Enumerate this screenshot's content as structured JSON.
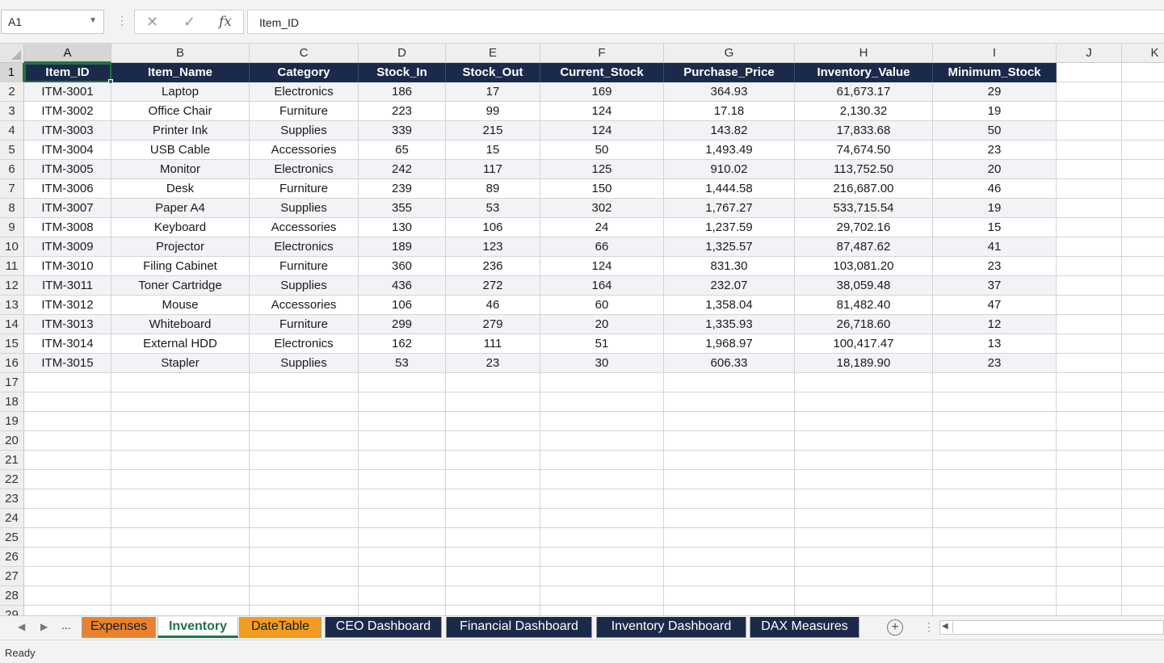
{
  "formula_bar": {
    "name_box": "A1",
    "formula": "Item_ID"
  },
  "columns": [
    "A",
    "B",
    "C",
    "D",
    "E",
    "F",
    "G",
    "H",
    "I",
    "J",
    "K"
  ],
  "table": {
    "headers": [
      "Item_ID",
      "Item_Name",
      "Category",
      "Stock_In",
      "Stock_Out",
      "Current_Stock",
      "Purchase_Price",
      "Inventory_Value",
      "Minimum_Stock"
    ],
    "rows": [
      [
        "ITM-3001",
        "Laptop",
        "Electronics",
        "186",
        "17",
        "169",
        "364.93",
        "61,673.17",
        "29"
      ],
      [
        "ITM-3002",
        "Office Chair",
        "Furniture",
        "223",
        "99",
        "124",
        "17.18",
        "2,130.32",
        "19"
      ],
      [
        "ITM-3003",
        "Printer Ink",
        "Supplies",
        "339",
        "215",
        "124",
        "143.82",
        "17,833.68",
        "50"
      ],
      [
        "ITM-3004",
        "USB Cable",
        "Accessories",
        "65",
        "15",
        "50",
        "1,493.49",
        "74,674.50",
        "23"
      ],
      [
        "ITM-3005",
        "Monitor",
        "Electronics",
        "242",
        "117",
        "125",
        "910.02",
        "113,752.50",
        "20"
      ],
      [
        "ITM-3006",
        "Desk",
        "Furniture",
        "239",
        "89",
        "150",
        "1,444.58",
        "216,687.00",
        "46"
      ],
      [
        "ITM-3007",
        "Paper A4",
        "Supplies",
        "355",
        "53",
        "302",
        "1,767.27",
        "533,715.54",
        "19"
      ],
      [
        "ITM-3008",
        "Keyboard",
        "Accessories",
        "130",
        "106",
        "24",
        "1,237.59",
        "29,702.16",
        "15"
      ],
      [
        "ITM-3009",
        "Projector",
        "Electronics",
        "189",
        "123",
        "66",
        "1,325.57",
        "87,487.62",
        "41"
      ],
      [
        "ITM-3010",
        "Filing Cabinet",
        "Furniture",
        "360",
        "236",
        "124",
        "831.30",
        "103,081.20",
        "23"
      ],
      [
        "ITM-3011",
        "Toner Cartridge",
        "Supplies",
        "436",
        "272",
        "164",
        "232.07",
        "38,059.48",
        "37"
      ],
      [
        "ITM-3012",
        "Mouse",
        "Accessories",
        "106",
        "46",
        "60",
        "1,358.04",
        "81,482.40",
        "47"
      ],
      [
        "ITM-3013",
        "Whiteboard",
        "Furniture",
        "299",
        "279",
        "20",
        "1,335.93",
        "26,718.60",
        "12"
      ],
      [
        "ITM-3014",
        "External HDD",
        "Electronics",
        "162",
        "111",
        "51",
        "1,968.97",
        "100,417.47",
        "13"
      ],
      [
        "ITM-3015",
        "Stapler",
        "Supplies",
        "53",
        "23",
        "30",
        "606.33",
        "18,189.90",
        "23"
      ]
    ]
  },
  "sheet_tabs": {
    "overflow": "...",
    "tabs": [
      {
        "label": "Expenses",
        "color": "#e8822f"
      },
      {
        "label": "Inventory",
        "active": true
      },
      {
        "label": "DateTable",
        "color": "#f39c1f"
      },
      {
        "label": "CEO Dashboard",
        "color": "#1b2a4a"
      },
      {
        "label": "Financial Dashboard",
        "color": "#1b2a4a"
      },
      {
        "label": "Inventory Dashboard",
        "color": "#1b2a4a"
      },
      {
        "label": "DAX Measures",
        "color": "#1b2a4a"
      }
    ]
  },
  "status": "Ready",
  "icons": {
    "cancel": "x-icon",
    "enter": "check-icon",
    "function": "fx-icon",
    "add_sheet": "plus-circle-icon"
  },
  "theme": {
    "header_fill": "#1b2a4a",
    "band_fill": "#f2f3f7",
    "accent": "#217346"
  }
}
